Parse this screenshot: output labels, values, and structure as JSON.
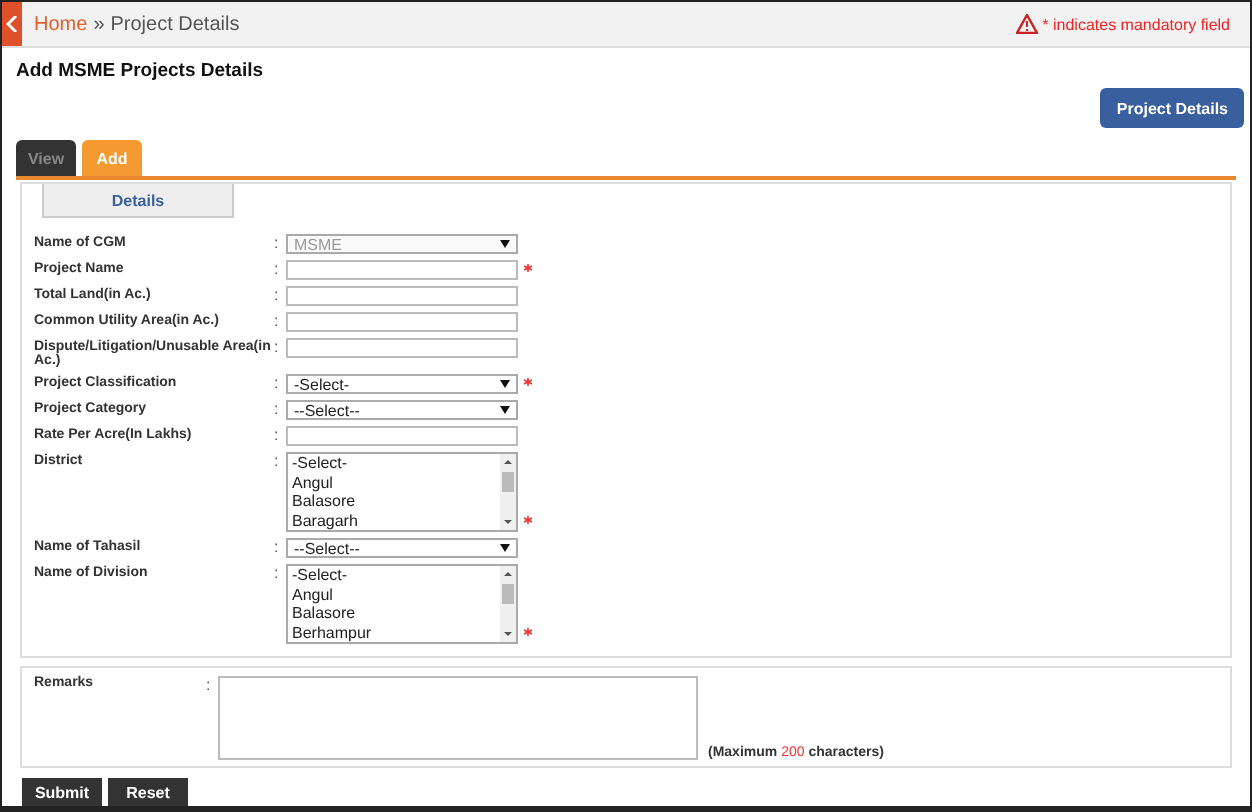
{
  "breadcrumb": {
    "home": "Home",
    "separator": "»",
    "current": "Project Details"
  },
  "mandatory_note": "* indicates mandatory field",
  "page_title": "Add MSME Projects Details",
  "project_details_button": "Project Details",
  "tabs": [
    {
      "label": "View",
      "selected": false
    },
    {
      "label": "Add",
      "selected": true
    }
  ],
  "section_tab": "Details",
  "separator": ":",
  "fields": [
    {
      "kind": "select",
      "label": "Name of CGM",
      "value": "MSME",
      "disabled": true,
      "required": false
    },
    {
      "kind": "text",
      "label": "Project Name",
      "required": true
    },
    {
      "kind": "text",
      "label": "Total Land(in Ac.)",
      "required": false
    },
    {
      "kind": "text",
      "label": "Common Utility Area(in Ac.)",
      "required": false
    },
    {
      "kind": "text",
      "label": "Dispute/Litigation/Unusable Area(in Ac.)",
      "required": false
    },
    {
      "kind": "select",
      "label": "Project Classification",
      "value": "-Select-",
      "disabled": false,
      "required": true
    },
    {
      "kind": "select",
      "label": "Project Category",
      "value": "--Select--",
      "disabled": false,
      "required": false
    },
    {
      "kind": "text",
      "label": "Rate Per Acre(In Lakhs)",
      "required": false
    },
    {
      "kind": "listbox",
      "label": "District",
      "options": [
        "-Select-",
        "Angul",
        "Balasore",
        "Baragarh"
      ],
      "required": true
    },
    {
      "kind": "select",
      "label": "Name of Tahasil",
      "value": "--Select--",
      "disabled": false,
      "required": false
    },
    {
      "kind": "listbox",
      "label": "Name of Division",
      "options": [
        "-Select-",
        "Angul",
        "Balasore",
        "Berhampur"
      ],
      "required": true
    }
  ],
  "remarks": {
    "label": "Remarks",
    "hint_prefix": "(Maximum",
    "hint_limit": "200",
    "hint_suffix": "characters)"
  },
  "buttons": [
    "Submit",
    "Reset"
  ]
}
